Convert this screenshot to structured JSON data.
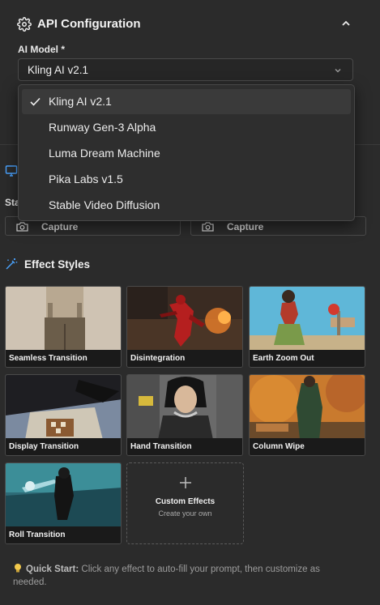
{
  "header": {
    "title": "API Configuration",
    "gear_icon": "gear-icon",
    "collapse_icon": "chevron-up-icon"
  },
  "model": {
    "label": "AI Model *",
    "selected": "Kling AI v2.1",
    "options": [
      "Kling AI v2.1",
      "Runway Gen-3 Alpha",
      "Luma Dream Machine",
      "Pika Labs v1.5",
      "Stable Video Diffusion"
    ]
  },
  "source": {
    "label_partial": "Sta",
    "capture_left": "Capture",
    "capture_right": "Capture"
  },
  "effects": {
    "title": "Effect Styles",
    "items": [
      "Seamless Transition",
      "Disintegration",
      "Earth Zoom Out",
      "Display Transition",
      "Hand Transition",
      "Column Wipe",
      "Roll Transition"
    ],
    "custom": {
      "title": "Custom Effects",
      "subtitle": "Create your own"
    }
  },
  "tip": {
    "label": "Quick Start:",
    "text": "Click any effect to auto-fill your prompt, then customize as needed."
  },
  "colors": {
    "panel": "#2b2b2b",
    "accent_orange": "#e0a25a",
    "muted": "#9c9c9c"
  }
}
